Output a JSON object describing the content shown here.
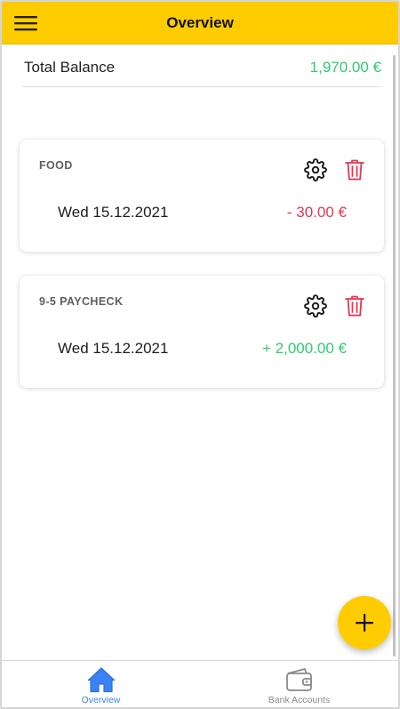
{
  "app": {
    "title": "Overview"
  },
  "header": {
    "menu_icon": "hamburger-menu-icon"
  },
  "balance": {
    "label": "Total Balance",
    "value": "1,970.00 €"
  },
  "transactions": [
    {
      "category": "FOOD",
      "date": "Wed 15.12.2021",
      "amount": "- 30.00 €",
      "type": "expense"
    },
    {
      "category": "9-5 PAYCHECK",
      "date": "Wed 15.12.2021",
      "amount": "+ 2,000.00 €",
      "type": "income"
    }
  ],
  "fab": {
    "icon": "plus-icon"
  },
  "bottom_nav": {
    "items": [
      {
        "label": "Overview",
        "icon": "home-icon",
        "active": true
      },
      {
        "label": "Bank Accounts",
        "icon": "wallet-icon",
        "active": false
      }
    ]
  },
  "colors": {
    "accent": "#ffcc00",
    "positive": "#2ecc71",
    "negative": "#e8364f",
    "active_nav": "#3b82f6",
    "inactive_nav": "#8a8a8a"
  }
}
